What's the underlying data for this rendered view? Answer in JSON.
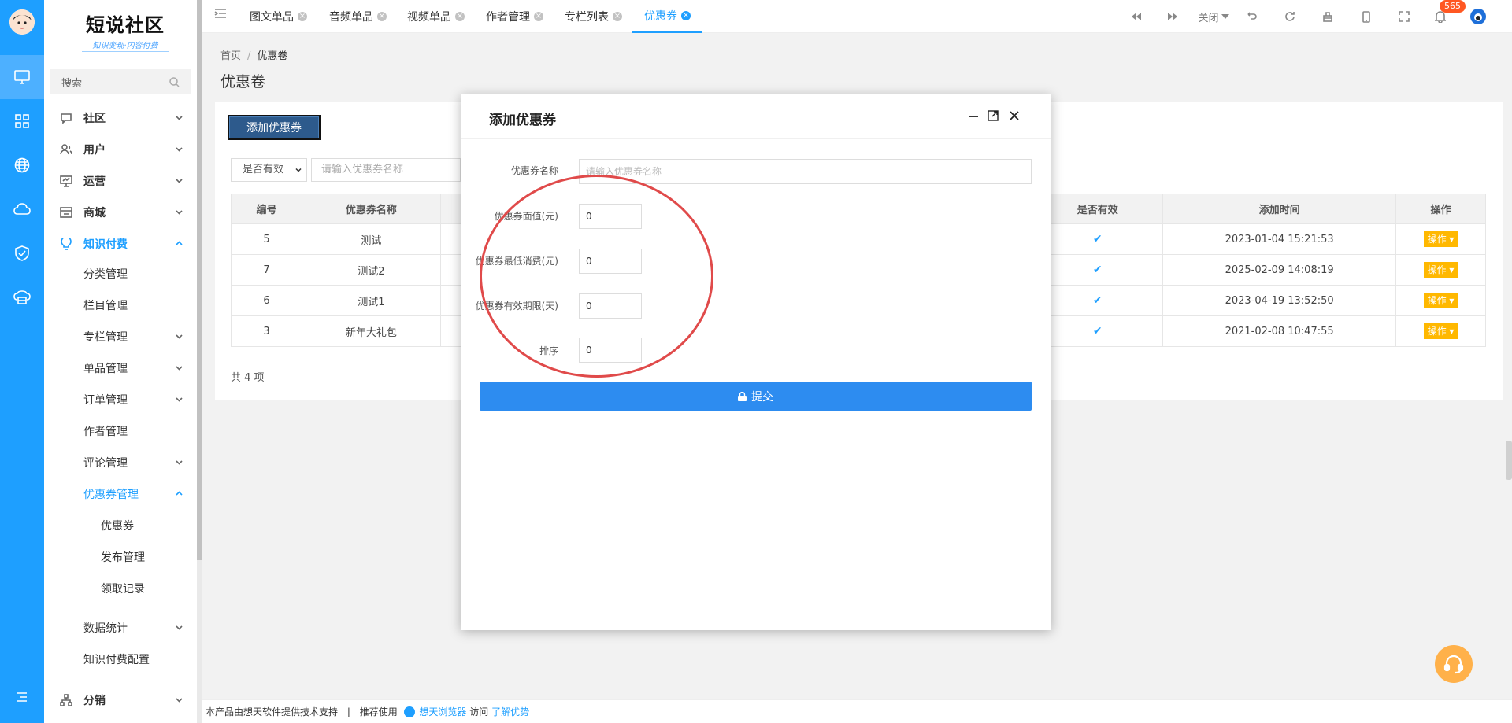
{
  "sidebar": {
    "logo_title": "短说社区",
    "logo_sub": "知识变现·内容付费",
    "search_placeholder": "搜索",
    "items": [
      {
        "label": "社区"
      },
      {
        "label": "用户"
      },
      {
        "label": "运营"
      },
      {
        "label": "商城"
      },
      {
        "label": "知识付费"
      },
      {
        "label": "分类管理"
      },
      {
        "label": "栏目管理"
      },
      {
        "label": "专栏管理"
      },
      {
        "label": "单品管理"
      },
      {
        "label": "订单管理"
      },
      {
        "label": "作者管理"
      },
      {
        "label": "评论管理"
      },
      {
        "label": "优惠券管理"
      },
      {
        "label": "优惠券"
      },
      {
        "label": "发布管理"
      },
      {
        "label": "领取记录"
      },
      {
        "label": "数据统计"
      },
      {
        "label": "知识付费配置"
      },
      {
        "label": "分销"
      }
    ]
  },
  "tabs": [
    {
      "label": "图文单品"
    },
    {
      "label": "音频单品"
    },
    {
      "label": "视频单品"
    },
    {
      "label": "作者管理"
    },
    {
      "label": "专栏列表"
    },
    {
      "label": "优惠券"
    }
  ],
  "toolbar": {
    "close_label": "关闭",
    "notification_count": "565"
  },
  "breadcrumb": {
    "home": "首页",
    "separator": "/",
    "current": "优惠卷"
  },
  "page_title": "优惠卷",
  "add_button": "添加优惠券",
  "filter": {
    "valid_select": "是否有效",
    "name_placeholder": "请输入优惠券名称"
  },
  "table": {
    "columns": [
      "编号",
      "优惠券名称",
      "是否有效",
      "添加时间",
      "操作"
    ],
    "rows": [
      {
        "id": "5",
        "name": "测试",
        "valid": "✔",
        "time": "2023-01-04 15:21:53",
        "op": "操作"
      },
      {
        "id": "7",
        "name": "测试2",
        "valid": "✔",
        "time": "2025-02-09 14:08:19",
        "op": "操作"
      },
      {
        "id": "6",
        "name": "测试1",
        "valid": "✔",
        "time": "2023-04-19 13:52:50",
        "op": "操作"
      },
      {
        "id": "3",
        "name": "新年大礼包",
        "valid": "✔",
        "time": "2021-02-08 10:47:55",
        "op": "操作"
      }
    ],
    "total": "共 4 项"
  },
  "modal": {
    "title": "添加优惠券",
    "fields": [
      {
        "label": "优惠券名称",
        "placeholder": "请输入优惠券名称",
        "value": ""
      },
      {
        "label": "优惠券面值(元)",
        "value": "0"
      },
      {
        "label": "优惠券最低消费(元)",
        "value": "0"
      },
      {
        "label": "优惠券有效期限(天)",
        "value": "0"
      },
      {
        "label": "排序",
        "value": "0"
      }
    ],
    "submit_label": "提交"
  },
  "footer": {
    "text1": "本产品由想天软件提供技术支持",
    "sep": "|",
    "text2": "推荐使用",
    "browser": "想天浏览器",
    "text3": "访问",
    "link": "了解优势"
  },
  "colors": {
    "accent": "#1e9fff",
    "warn": "#ffb800",
    "annotation": "#e04a4a"
  }
}
